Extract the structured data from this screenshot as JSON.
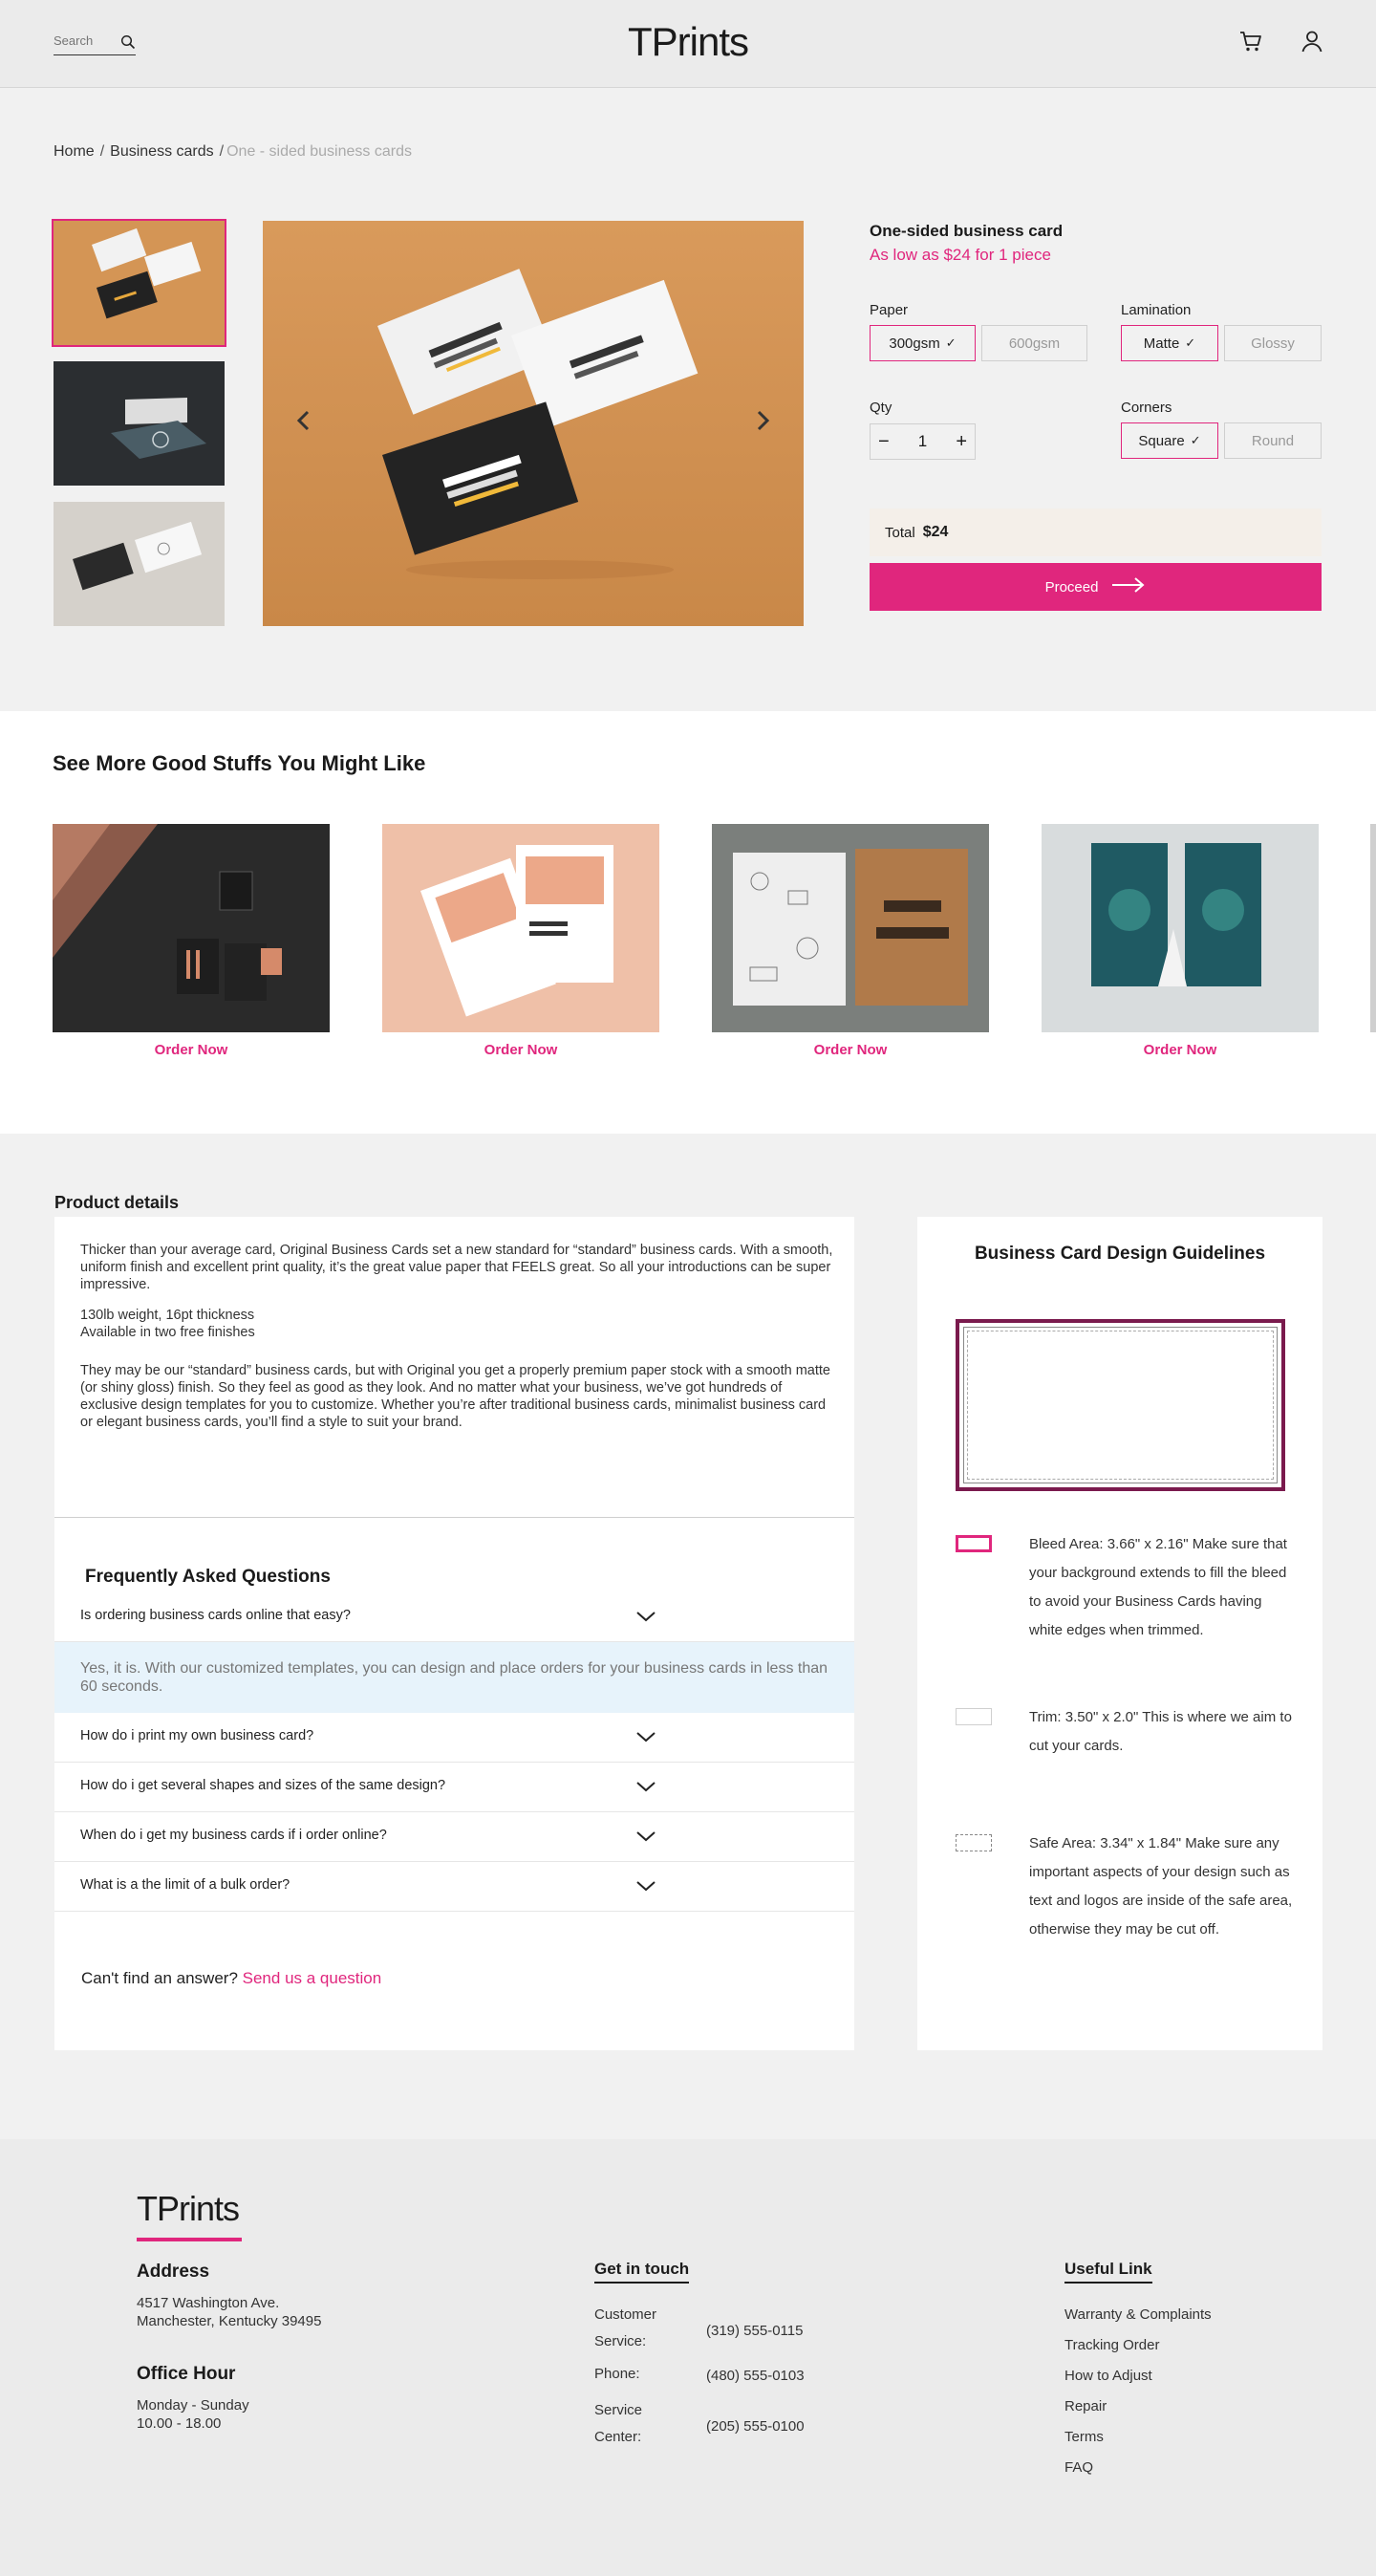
{
  "header": {
    "search_placeholder": "Search",
    "logo": "TPrints"
  },
  "breadcrumb": {
    "home": "Home",
    "category": "Business cards",
    "current": "One - sided business cards",
    "sep1": "/",
    "sep2": "/"
  },
  "product": {
    "title": "One-sided business card",
    "price_line": "As low as $24  for 1 piece",
    "paper": {
      "label": "Paper",
      "options": [
        "300gsm",
        "600gsm"
      ],
      "selected": "300gsm"
    },
    "lamination": {
      "label": "Lamination",
      "options": [
        "Matte",
        "Glossy"
      ],
      "selected": "Matte"
    },
    "qty": {
      "label": "Qty",
      "value": "1",
      "minus": "−",
      "plus": "+"
    },
    "corners": {
      "label": "Corners",
      "options": [
        "Square",
        "Round"
      ],
      "selected": "Square"
    },
    "total_label": "Total",
    "total_value": "$24",
    "proceed_label": "Proceed",
    "check_glyph": "✓"
  },
  "recommendations": {
    "title": "See More Good Stuffs You Might Like",
    "items": [
      {
        "order_label": "Order Now"
      },
      {
        "order_label": "Order Now"
      },
      {
        "order_label": "Order Now"
      },
      {
        "order_label": "Order Now"
      }
    ]
  },
  "details": {
    "title": "Product details",
    "para1": "Thicker than your average card, Original Business Cards set a new standard for “standard” business cards. With a smooth, uniform finish and excellent print quality, it’s the great value paper that FEELS great. So all your introductions can be super impressive.",
    "para2_line1": "130lb weight, 16pt thickness",
    "para2_line2": "Available in two free finishes",
    "para3": "They may be our “standard” business cards, but with Original you get a properly premium paper stock with a smooth matte (or shiny gloss) finish. So they feel as good as they look. And no matter what your business, we’ve got hundreds of exclusive design templates for you to customize. Whether you’re after traditional business cards, minimalist business card or elegant business cards, you’ll find a style to suit your brand.",
    "faq_title": "Frequently Asked Questions",
    "faq": [
      {
        "q": "Is ordering business cards online that easy?"
      },
      {
        "q": "How do i print my own business card?"
      },
      {
        "q": "How do i get several shapes and sizes of the same design?"
      },
      {
        "q": "When do i get my business cards if i order online?"
      },
      {
        "q": "What is a the limit of a bulk order?"
      }
    ],
    "faq_answer": "Yes, it is. With our customized templates, you can design and place orders for your business cards in less than 60 seconds.",
    "cant_find": "Can't find an answer?",
    "send_question": "Send us a question"
  },
  "guidelines": {
    "title": "Business Card Design Guidelines",
    "items": [
      {
        "text": "Bleed Area: 3.66\" x 2.16\" Make sure that your background extends to fill the bleed to avoid your Business Cards having white edges when trimmed."
      },
      {
        "text": "Trim: 3.50\" x 2.0\" This is where we aim to cut your cards."
      },
      {
        "text": "Safe Area: 3.34\" x 1.84\" Make sure any important aspects of your design such as text and logos are inside of the safe area, otherwise they may be cut off."
      }
    ],
    "colors": {
      "bleed": "#e0267d",
      "trim": "#cfcfcf",
      "safe": "#888888"
    }
  },
  "footer": {
    "logo": "TPrints",
    "address_title": "Address",
    "address_line1": "4517 Washington Ave.",
    "address_line2": "Manchester, Kentucky 39495",
    "office_title": "Office Hour",
    "office_line1": "Monday - Sunday",
    "office_line2": "10.00 - 18.00",
    "contact_title": "Get in touch",
    "contacts": [
      {
        "label1": "Customer",
        "label2": "Service:",
        "value": "(319) 555-0115"
      },
      {
        "label1": "Phone:",
        "label2": "",
        "value": "(480) 555-0103"
      },
      {
        "label1": "Service",
        "label2": "Center:",
        "value": "(205) 555-0100"
      }
    ],
    "links_title": "Useful Link",
    "links": [
      "Warranty & Complaints",
      "Tracking Order",
      "How to Adjust",
      "Repair",
      "Terms",
      "FAQ"
    ]
  },
  "colors": {
    "accent": "#e0267d",
    "header_bg": "#ebebeb",
    "page_bg": "#f1f1f1"
  }
}
